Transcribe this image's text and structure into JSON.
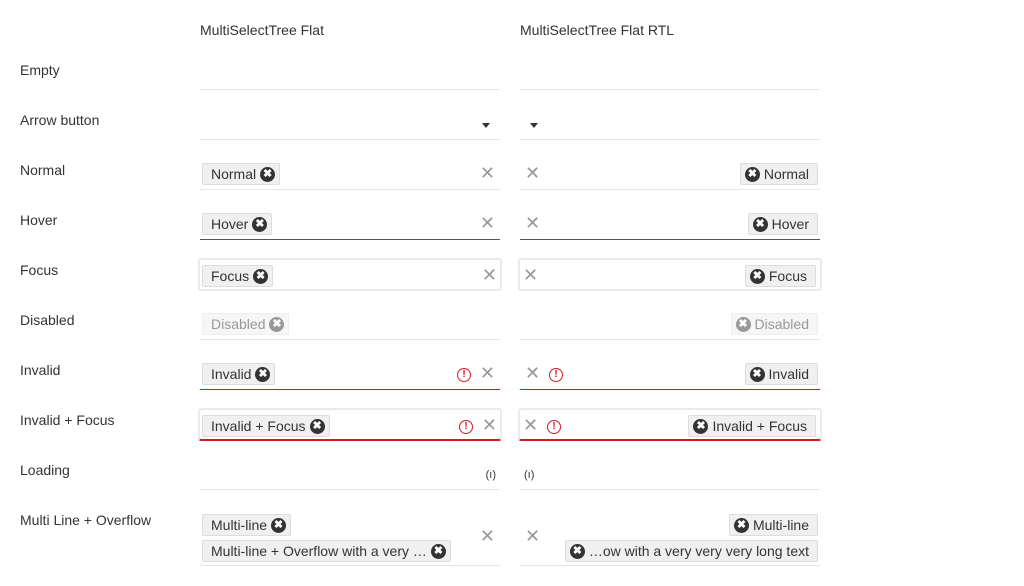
{
  "columns": [
    "MultiSelectTree Flat",
    "MultiSelectTree Flat RTL"
  ],
  "rows": [
    {
      "label": "Empty",
      "chips": [],
      "clear": false
    },
    {
      "label": "Arrow button",
      "chips": [],
      "arrow": true
    },
    {
      "label": "Normal",
      "chips": [
        "Normal"
      ],
      "clear": true
    },
    {
      "label": "Hover",
      "chips": [
        "Hover"
      ],
      "clear": true,
      "state": "hover"
    },
    {
      "label": "Focus",
      "chips": [
        "Focus"
      ],
      "clear": true,
      "state": "focus"
    },
    {
      "label": "Disabled",
      "chips": [
        "Disabled"
      ],
      "state": "disabled"
    },
    {
      "label": "Invalid",
      "chips": [
        "Invalid"
      ],
      "clear": true,
      "invalid": true
    },
    {
      "label": "Invalid + Focus",
      "chips": [
        "Invalid + Focus"
      ],
      "clear": true,
      "invalid": true,
      "state": "focus"
    },
    {
      "label": "Loading",
      "chips": [],
      "loading": true
    },
    {
      "label": "Multi Line + Overflow",
      "chips": [
        "Multi-line",
        "Multi-line + Overflow with a very …"
      ],
      "chips_rtl": [
        "Multi-line",
        "…ow with a very very very long text"
      ],
      "clear": true
    }
  ],
  "icons": {
    "clear": "✕",
    "remove": "✖",
    "warning": "!",
    "loading": "(ı)"
  },
  "colors": {
    "invalid": "#d51923",
    "chip_bg": "#f0f0f0"
  }
}
